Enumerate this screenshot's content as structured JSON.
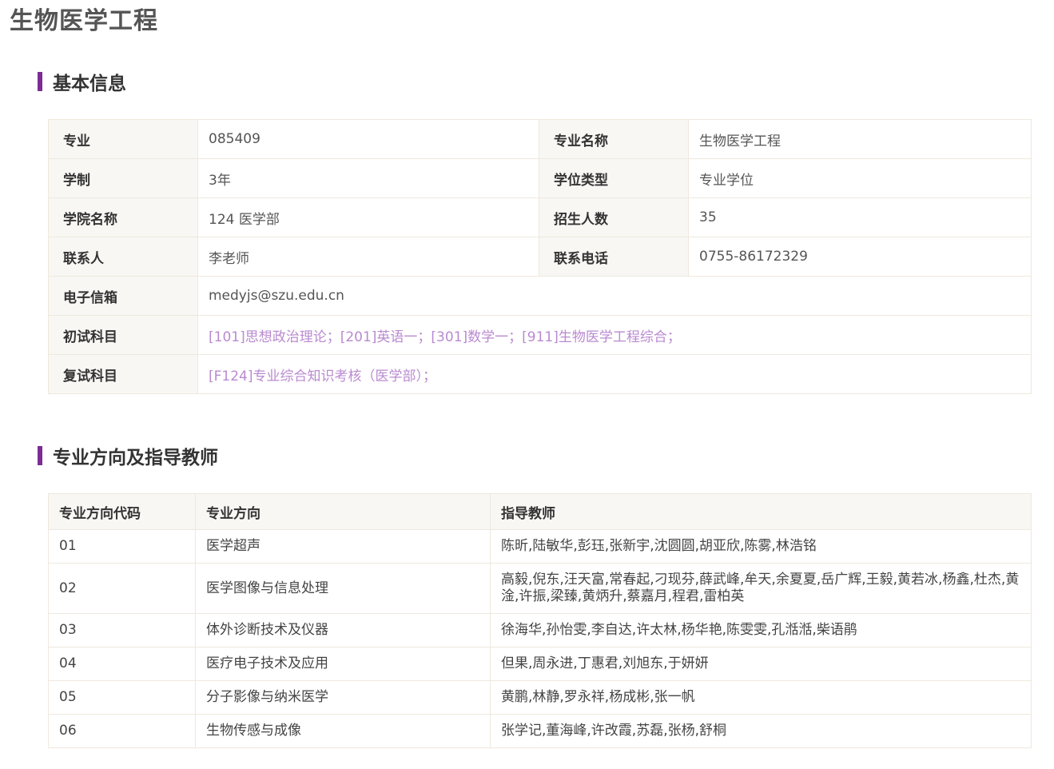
{
  "page_title": "生物医学工程",
  "sections": {
    "basic_info": "基本信息",
    "directions": "专业方向及指导教师"
  },
  "basic_info": {
    "major_label": "专业",
    "major_value": "085409",
    "major_name_label": "专业名称",
    "major_name_value": "生物医学工程",
    "duration_label": "学制",
    "duration_value": "3年",
    "degree_type_label": "学位类型",
    "degree_type_value": "专业学位",
    "college_label": "学院名称",
    "college_value": "124 医学部",
    "enrollment_label": "招生人数",
    "enrollment_value": "35",
    "contact_label": "联系人",
    "contact_value": "李老师",
    "phone_label": "联系电话",
    "phone_value": "0755-86172329",
    "email_label": "电子信箱",
    "email_value": "medyjs@szu.edu.cn",
    "prelim_label": "初试科目",
    "prelim_value": "[101]思想政治理论；[201]英语一；[301]数学一；[911]生物医学工程综合；",
    "retest_label": "复试科目",
    "retest_value": "[F124]专业综合知识考核（医学部）；"
  },
  "directions_table": {
    "headers": [
      "专业方向代码",
      "专业方向",
      "指导教师"
    ],
    "rows": [
      {
        "code": "01",
        "direction": "医学超声",
        "advisors": "陈昕,陆敏华,彭珏,张新宇,沈圆圆,胡亚欣,陈雾,林浩铭"
      },
      {
        "code": "02",
        "direction": "医学图像与信息处理",
        "advisors": "高毅,倪东,汪天富,常春起,刁现芬,薛武峰,牟天,余夏夏,岳广辉,王毅,黄若冰,杨鑫,杜杰,黄淦,许振,梁臻,黄炳升,蔡嘉月,程君,雷柏英"
      },
      {
        "code": "03",
        "direction": "体外诊断技术及仪器",
        "advisors": "徐海华,孙怡雯,李自达,许太林,杨华艳,陈雯雯,孔湉湉,柴语鹃"
      },
      {
        "code": "04",
        "direction": "医疗电子技术及应用",
        "advisors": "但果,周永进,丁惠君,刘旭东,于妍妍"
      },
      {
        "code": "05",
        "direction": "分子影像与纳米医学",
        "advisors": "黄鹏,林静,罗永祥,杨成彬,张一帆"
      },
      {
        "code": "06",
        "direction": "生物传感与成像",
        "advisors": "张学记,董海峰,许改霞,苏磊,张杨,舒桐"
      }
    ]
  },
  "colors": {
    "accent_bar": "#7b2d95",
    "link_text": "#b98ad0",
    "header_bg": "#f8f7f4",
    "border": "#efe9de"
  }
}
